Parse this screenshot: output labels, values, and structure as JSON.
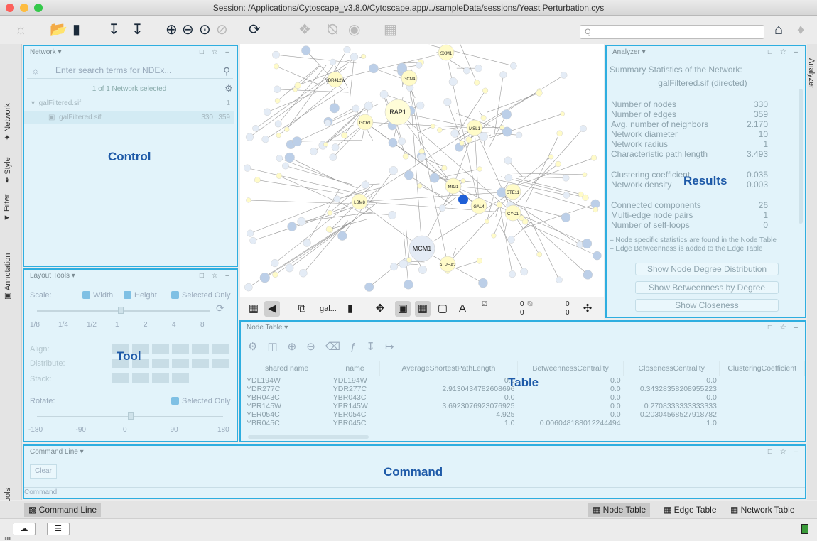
{
  "window": {
    "title": "Session: /Applications/Cytoscape_v3.8.0/Cytoscape.app/../sampleData/sessions/Yeast Perturbation.cys"
  },
  "toolbar": {
    "search_placeholder": "Q",
    "icons": [
      "ndex-icon",
      "open-icon",
      "save-icon",
      "import-network-icon",
      "import-table-icon",
      "zoom-in-icon",
      "zoom-out-icon",
      "zoom-fit-icon",
      "zoom-selected-icon",
      "refresh-icon",
      "first-neighbors-icon",
      "hide-icon",
      "show-icon",
      "help-icon",
      "home-icon",
      "notification-icon"
    ]
  },
  "left_tabs": {
    "network": "Network",
    "style": "Style",
    "filter": "Filter",
    "annotation": "Annotation",
    "layout_tools": "Layout Tools"
  },
  "right_tabs": {
    "analyzer": "Analyzer"
  },
  "network_panel": {
    "title": "Network ▾",
    "search_placeholder": "Enter search terms for NDEx...",
    "selection_text": "1 of 1 Network selected",
    "collection": {
      "name": "galFiltered.sif",
      "count": "1"
    },
    "network": {
      "name": "galFiltered.sif",
      "nodes": "330",
      "edges": "359"
    },
    "overlay": "Control"
  },
  "layout_panel": {
    "title": "Layout Tools ▾",
    "scale_label": "Scale:",
    "width_label": "Width",
    "height_label": "Height",
    "selected_only": "Selected Only",
    "scale_ticks": [
      "1/8",
      "1/4",
      "1/2",
      "1",
      "2",
      "4",
      "8"
    ],
    "align_label": "Align:",
    "distribute_label": "Distribute:",
    "stack_label": "Stack:",
    "rotate_label": "Rotate:",
    "rotate_selected_only": "Selected Only",
    "rotate_ticks": [
      "-180",
      "-90",
      "0",
      "90",
      "180"
    ],
    "overlay": "Tool"
  },
  "network_view": {
    "nodes": [
      {
        "label": "RAP1",
        "big": true
      },
      {
        "label": "MCM1",
        "big": true
      },
      {
        "label": "MIG1"
      },
      {
        "label": "GAL4"
      },
      {
        "label": "STE11"
      },
      {
        "label": "CYC1"
      },
      {
        "label": "GCN4"
      },
      {
        "label": "SXM1"
      },
      {
        "label": "YDR412W"
      },
      {
        "label": "GCR1"
      },
      {
        "label": "ALPHA2"
      },
      {
        "label": "LSM8"
      },
      {
        "label": "MSL1"
      }
    ],
    "toolbar_label": "gal...",
    "counts": {
      "a1": "0",
      "a2": "0",
      "b1": "0",
      "b2": "0"
    }
  },
  "analyzer_panel": {
    "title": "Analyzer ▾",
    "heading": "Summary Statistics of the Network:",
    "network_name": "galFiltered.sif (directed)",
    "stats": [
      {
        "label": "Number of nodes",
        "value": "330"
      },
      {
        "label": "Number of edges",
        "value": "359"
      },
      {
        "label": "Avg. number of neighbors",
        "value": "2.170"
      },
      {
        "label": "Network diameter",
        "value": "10"
      },
      {
        "label": "Network radius",
        "value": "1"
      },
      {
        "label": "Characteristic path length",
        "value": "3.493"
      },
      {
        "label": "Clustering coefficient",
        "value": "0.035"
      },
      {
        "label": "Network density",
        "value": "0.003"
      },
      {
        "label": "Connected components",
        "value": "26"
      },
      {
        "label": "Multi-edge node pairs",
        "value": "1"
      },
      {
        "label": "Number of self-loops",
        "value": "0"
      }
    ],
    "note1": "– Node specific statistics are found in the Node Table",
    "note2": "– Edge Betweenness is added to the Edge Table",
    "buttons": [
      "Show Node Degree Distribution",
      "Show Betweenness by Degree",
      "Show Closeness"
    ],
    "overlay": "Results"
  },
  "node_table": {
    "title": "Node Table ▾",
    "columns": [
      "shared name",
      "name",
      "AverageShortestPathLength",
      "BetweennessCentrality",
      "ClosenessCentrality",
      "ClusteringCoefficient"
    ],
    "rows": [
      [
        "YDL194W",
        "YDL194W",
        "0.0",
        "0.0",
        "0.0",
        ""
      ],
      [
        "YDR277C",
        "YDR277C",
        "2.9130434782608696",
        "0.0",
        "0.34328358208955223",
        ""
      ],
      [
        "YBR043C",
        "YBR043C",
        "0.0",
        "0.0",
        "0.0",
        ""
      ],
      [
        "YPR145W",
        "YPR145W",
        "3.6923076923076925",
        "0.0",
        "0.2708333333333333",
        ""
      ],
      [
        "YER054C",
        "YER054C",
        "4.925",
        "0.0",
        "0.20304568527918782",
        ""
      ],
      [
        "YBR045C",
        "YBR045C",
        "1.0",
        "0.006048188012244494",
        "1.0",
        ""
      ]
    ],
    "overlay": "Table"
  },
  "command_panel": {
    "title": "Command Line ▾",
    "clear": "Clear",
    "prompt": "Command:",
    "overlay": "Command"
  },
  "bottom_tabs": {
    "command_line": "Command Line",
    "node_table": "Node Table",
    "edge_table": "Edge Table",
    "network_table": "Network Table"
  }
}
